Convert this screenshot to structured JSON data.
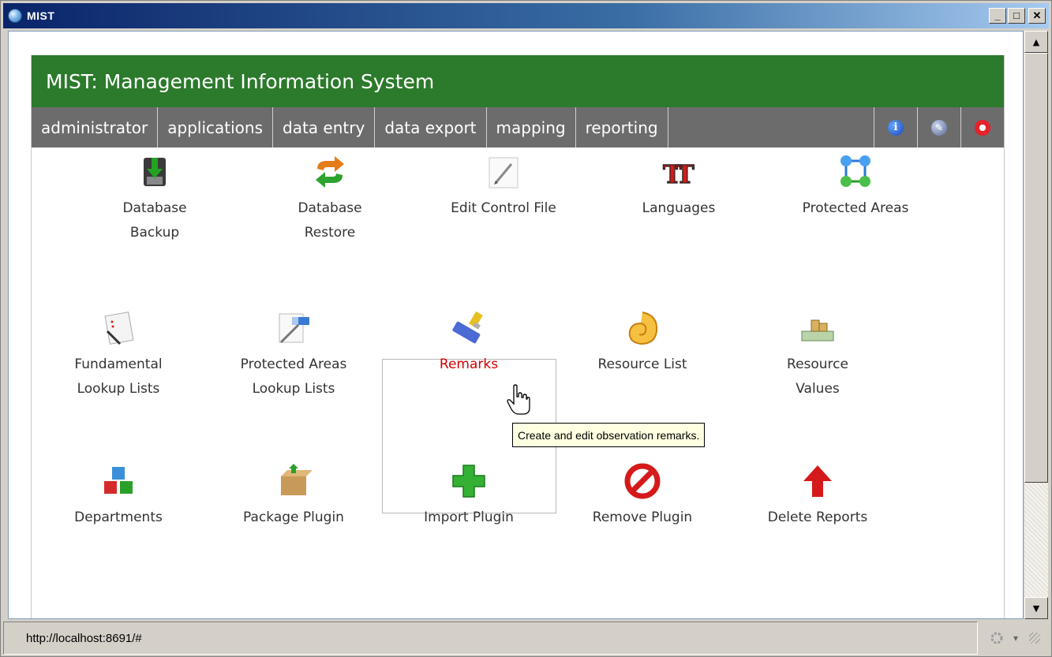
{
  "window": {
    "title": "MIST",
    "controls": {
      "minimize": "_",
      "maximize": "□",
      "close": "✕"
    }
  },
  "app": {
    "header_title": "MIST: Management Information System"
  },
  "menu": {
    "items": [
      {
        "label": "administrator"
      },
      {
        "label": "applications"
      },
      {
        "label": "data entry"
      },
      {
        "label": "data export"
      },
      {
        "label": "mapping"
      },
      {
        "label": "reporting"
      }
    ],
    "right_icons": [
      "info-icon",
      "edit-icon",
      "help-icon"
    ]
  },
  "tools": [
    {
      "label": "Database\nBackup",
      "icon": "database-backup-icon"
    },
    {
      "label": "Database\nRestore",
      "icon": "database-restore-icon"
    },
    {
      "label": "Edit Control File",
      "icon": "edit-control-file-icon"
    },
    {
      "label": "Languages",
      "icon": "languages-icon"
    },
    {
      "label": "Protected Areas",
      "icon": "protected-areas-icon"
    },
    {
      "label": "Fundamental\nLookup Lists",
      "icon": "fundamental-lookup-icon"
    },
    {
      "label": "Protected Areas\nLookup Lists",
      "icon": "protected-areas-lookup-icon"
    },
    {
      "label": "Remarks",
      "icon": "remarks-icon",
      "active": true
    },
    {
      "label": "Resource List",
      "icon": "resource-list-icon"
    },
    {
      "label": "Resource\nValues",
      "icon": "resource-values-icon"
    },
    {
      "label": "Departments",
      "icon": "departments-icon"
    },
    {
      "label": "Package Plugin",
      "icon": "package-plugin-icon"
    },
    {
      "label": "Import Plugin",
      "icon": "import-plugin-icon"
    },
    {
      "label": "Remove Plugin",
      "icon": "remove-plugin-icon"
    },
    {
      "label": "Delete Reports",
      "icon": "delete-reports-icon"
    }
  ],
  "tooltip": "Create and edit observation remarks.",
  "status": {
    "url": "http://localhost:8691/#"
  },
  "colors": {
    "header_green": "#2c7a2c",
    "menu_gray": "#6c6c6c",
    "active_label": "#d40000",
    "tooltip_bg": "#ffffe1"
  }
}
